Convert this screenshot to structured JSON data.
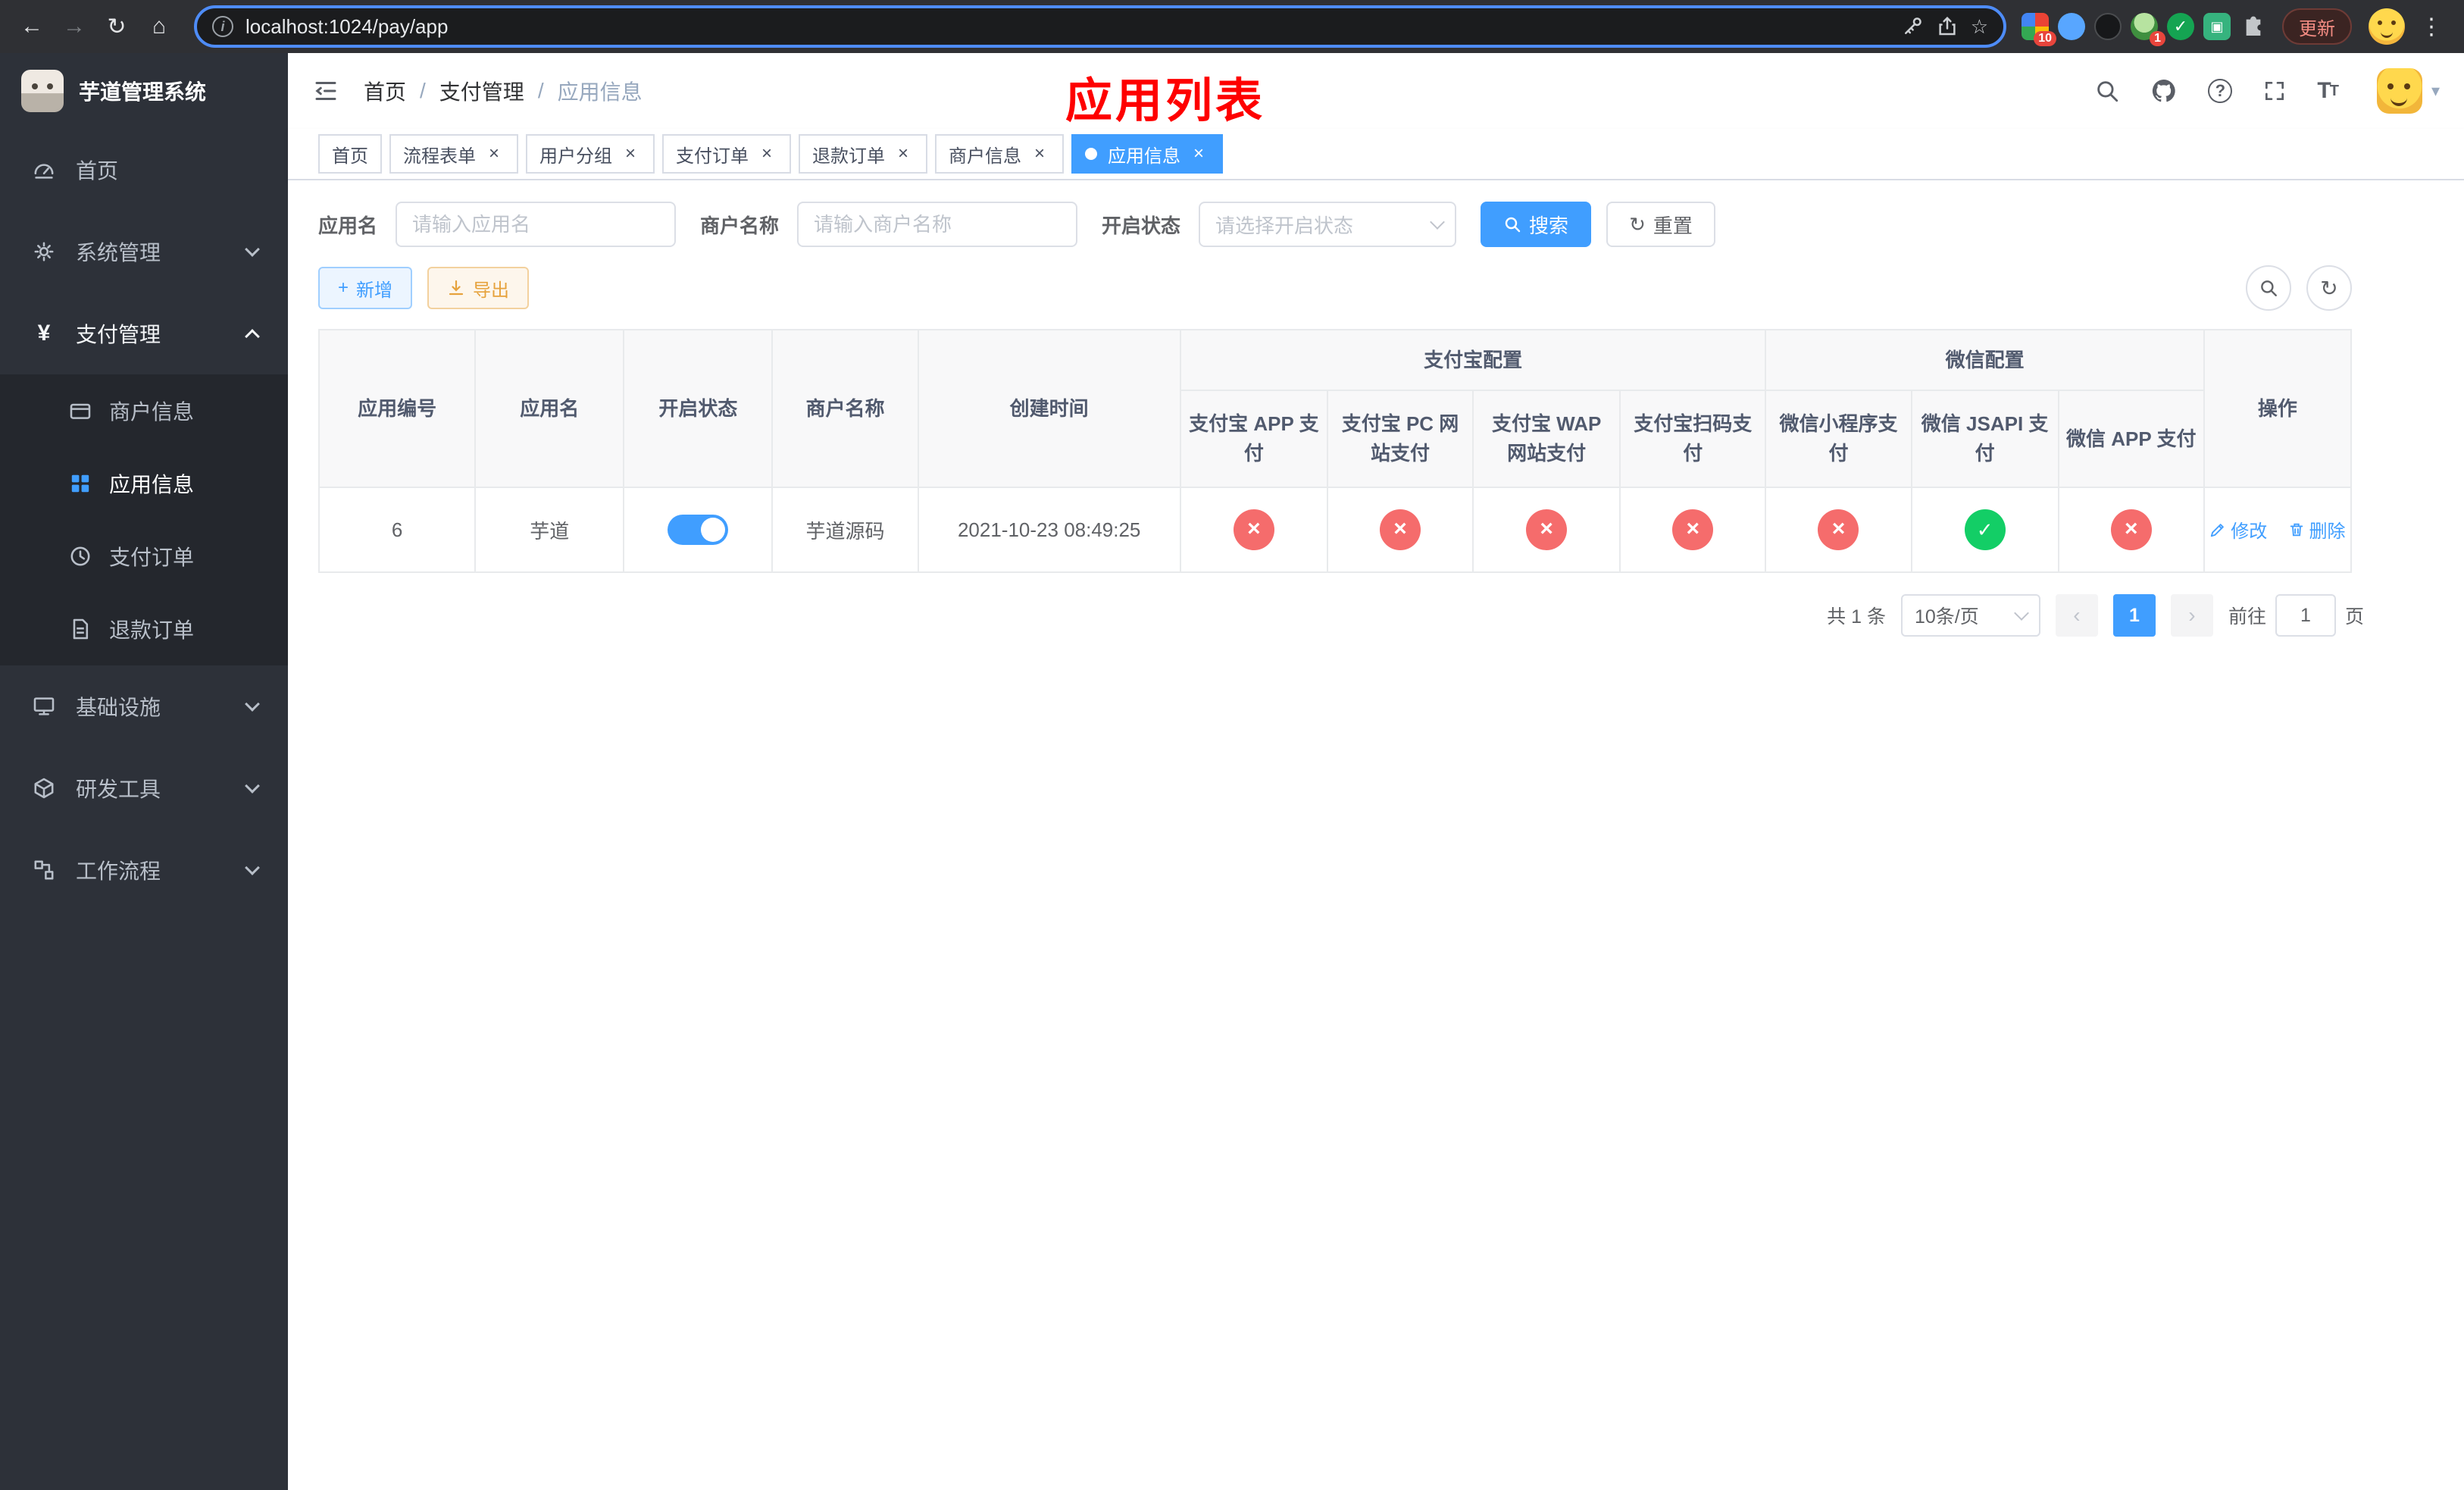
{
  "browser": {
    "url": "localhost:1024/pay/app",
    "update_button": "更新",
    "ext_badge_grid": "10",
    "ext_badge_avatar": "1"
  },
  "app": {
    "title": "芋道管理系统"
  },
  "sidebar": {
    "menu": [
      {
        "label": "首页"
      },
      {
        "label": "系统管理"
      },
      {
        "label": "支付管理"
      },
      {
        "label": "基础设施"
      },
      {
        "label": "研发工具"
      },
      {
        "label": "工作流程"
      }
    ],
    "submenu": [
      {
        "label": "商户信息"
      },
      {
        "label": "应用信息"
      },
      {
        "label": "支付订单"
      },
      {
        "label": "退款订单"
      }
    ]
  },
  "header": {
    "breadcrumb": [
      "首页",
      "支付管理",
      "应用信息"
    ],
    "annotation": "应用列表"
  },
  "tabs": [
    {
      "label": "首页"
    },
    {
      "label": "流程表单"
    },
    {
      "label": "用户分组"
    },
    {
      "label": "支付订单"
    },
    {
      "label": "退款订单"
    },
    {
      "label": "商户信息"
    },
    {
      "label": "应用信息"
    }
  ],
  "filters": {
    "app_name_label": "应用名",
    "app_name_placeholder": "请输入应用名",
    "merchant_label": "商户名称",
    "merchant_placeholder": "请输入商户名称",
    "status_label": "开启状态",
    "status_placeholder": "请选择开启状态",
    "search_button": "搜索",
    "reset_button": "重置"
  },
  "toolbar": {
    "add_button": "新增",
    "export_button": "导出"
  },
  "table": {
    "columns": [
      "应用编号",
      "应用名",
      "开启状态",
      "商户名称",
      "创建时间"
    ],
    "group_alipay": "支付宝配置",
    "group_wechat": "微信配置",
    "pay_columns": [
      "支付宝 APP 支付",
      "支付宝 PC 网站支付",
      "支付宝 WAP 网站支付",
      "支付宝扫码支付",
      "微信小程序支付",
      "微信 JSAPI 支付",
      "微信 APP 支付"
    ],
    "actions_column": "操作",
    "row": {
      "id": "6",
      "name": "芋道",
      "enabled": "on",
      "merchant": "芋道源码",
      "created": "2021-10-23 08:49:25",
      "statuses": [
        "x",
        "x",
        "x",
        "x",
        "x",
        "check",
        "x"
      ],
      "edit": "修改",
      "delete": "删除"
    }
  },
  "pagination": {
    "total": "共 1 条",
    "page_size": "10条/页",
    "page": "1",
    "goto_label": "前往",
    "goto_value": "1",
    "page_unit": "页"
  },
  "icons": {
    "back": "←",
    "forward": "→",
    "reload": "↻",
    "home": "⌂",
    "star": "☆",
    "more": "⋮",
    "caret": "▾",
    "question": "?",
    "font_large": "T",
    "font_small": "T",
    "yen": "¥",
    "plus": "+",
    "reset": "↻",
    "prev": "‹",
    "next": "›",
    "close": "×",
    "check": "✓",
    "chat": "▣"
  },
  "colors": {
    "primary": "#409eff",
    "success": "#13ce66",
    "danger": "#f56c6c",
    "warning_text": "#e6a23c",
    "annotation_red": "#fe0000",
    "sidebar_bg": "#2d3139",
    "submenu_bg": "#24272d",
    "tab_active": "#409eff"
  }
}
